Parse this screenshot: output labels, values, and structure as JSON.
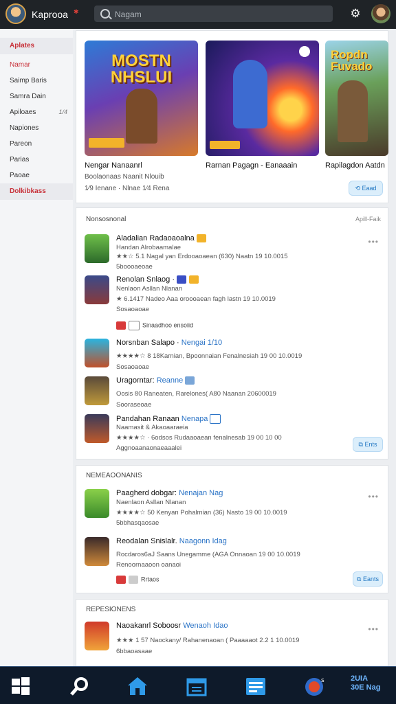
{
  "header": {
    "app_title": "Kaprooa",
    "search_placeholder": "Nagam"
  },
  "sidebar": {
    "items": [
      {
        "label": "Aplates"
      },
      {
        "label": "Namar"
      },
      {
        "label": "Saimp Baris"
      },
      {
        "label": "Samra Dain"
      },
      {
        "label": "Apiloaes",
        "count": "1/4"
      },
      {
        "label": "Napiones"
      },
      {
        "label": "Pareon"
      },
      {
        "label": "Parias"
      },
      {
        "label": "Paoae"
      },
      {
        "label": "Dolkibkass"
      }
    ]
  },
  "featured": {
    "cards": [
      {
        "title": "Nengar Nanaanrl",
        "art_text": "MOSTN NHSLUI"
      },
      {
        "title": "Rarnan Pagagn - Eanaaain"
      },
      {
        "title": "Rapilagdon Aatdn",
        "art_text": "Ropdn Fuvado"
      }
    ],
    "subtitle_1": "Boolaonaas Naanit Nlouib",
    "subtitle_2": "1⁄9 Ienane ·     Nlnae 1⁄4 Rena",
    "open_label": "Eaad"
  },
  "section_new": {
    "title": "Nonsosnonal",
    "right_label": "Apill-Faik",
    "open_label": "Ents",
    "apps": [
      {
        "title": "Aladalian Radaoaoalna",
        "line1": "Handan Alrobaamalae",
        "line2": "★★☆ 5.1  Nagal yan Erdooaoaean (630) Naatn  19 10.0015",
        "line3": "5boooaeoae"
      },
      {
        "title": "Renolan Snlaog ·",
        "line1": "Nenlaon Asllan Nlanan",
        "line2": "★ 6.1417 Nadeo Aaa oroooaean fagh lastn  19 10.0019",
        "line3": "Sosaoaoae",
        "tags": "Sinaadhoo ensoiid"
      },
      {
        "title": "Norsnban Salapo ·",
        "title_blue": "Nengai 1/10",
        "line2": "★★★★☆ 8 18Karnian, Bpoonnaian Fenalnesiah  19 00 10.0019",
        "line3": "Sosaoaoae"
      },
      {
        "title": "Uragorntar: ",
        "title_blue": "Reanne",
        "line2": "Oosis 80 Raneaten, Rarelones( A80 Naanan 20600019",
        "line3": "Sooraseoae"
      },
      {
        "title": "Pandahan Ranaan ",
        "title_blue": "Nenapa",
        "line1": "Naamasit & Akaoaaraeia",
        "line2": "★★★★☆ · 6odsos Rudaaoaean fenalnesab 19 00 10 00",
        "line3": "Aggnoaanaonaeaaalei"
      }
    ]
  },
  "section_rec": {
    "title": "NEMEAOONANIS",
    "open_label": "Eants",
    "apps": [
      {
        "title": "Paagherd dobgar: ",
        "title_blue": "Nenajan Nag",
        "line1": "Naenlaon Asllan Nlanan",
        "line2": "★★★★☆ 50 Kenyan Pohalmian (36) Nasto  19 00 10.0019",
        "line3": "5bbhasqaosae"
      },
      {
        "title": "Reodalan Snislalr. ",
        "title_blue": "Naagonn Idag",
        "line1": "Rocdaros6aJ Saans Unegamme (AGA Onnaoan 19 00 10.0019",
        "line2": "Renoornaaoon oanaoi",
        "tags": "Rrtaos"
      }
    ]
  },
  "section_pop": {
    "title": "REPESIONENS",
    "apps": [
      {
        "title": "Naoakanrl Soboosr ",
        "title_blue": "Wenaoh Idao",
        "line2": "★★★ 1 57  Naockany/ Rahanenaoan ( Paaaaaot 2.2 1 10.0019",
        "line3": "6bbaoasaae"
      }
    ]
  },
  "taskbar": {
    "clock_line1": "2UIA",
    "clock_line2": "30E Nag"
  },
  "colors": {
    "topbar": "#1f2327",
    "accent_blue": "#2a73c6",
    "sidebar_red": "#c8323a",
    "star": "#f0a41c",
    "taskbar": "#0e1a2a"
  }
}
